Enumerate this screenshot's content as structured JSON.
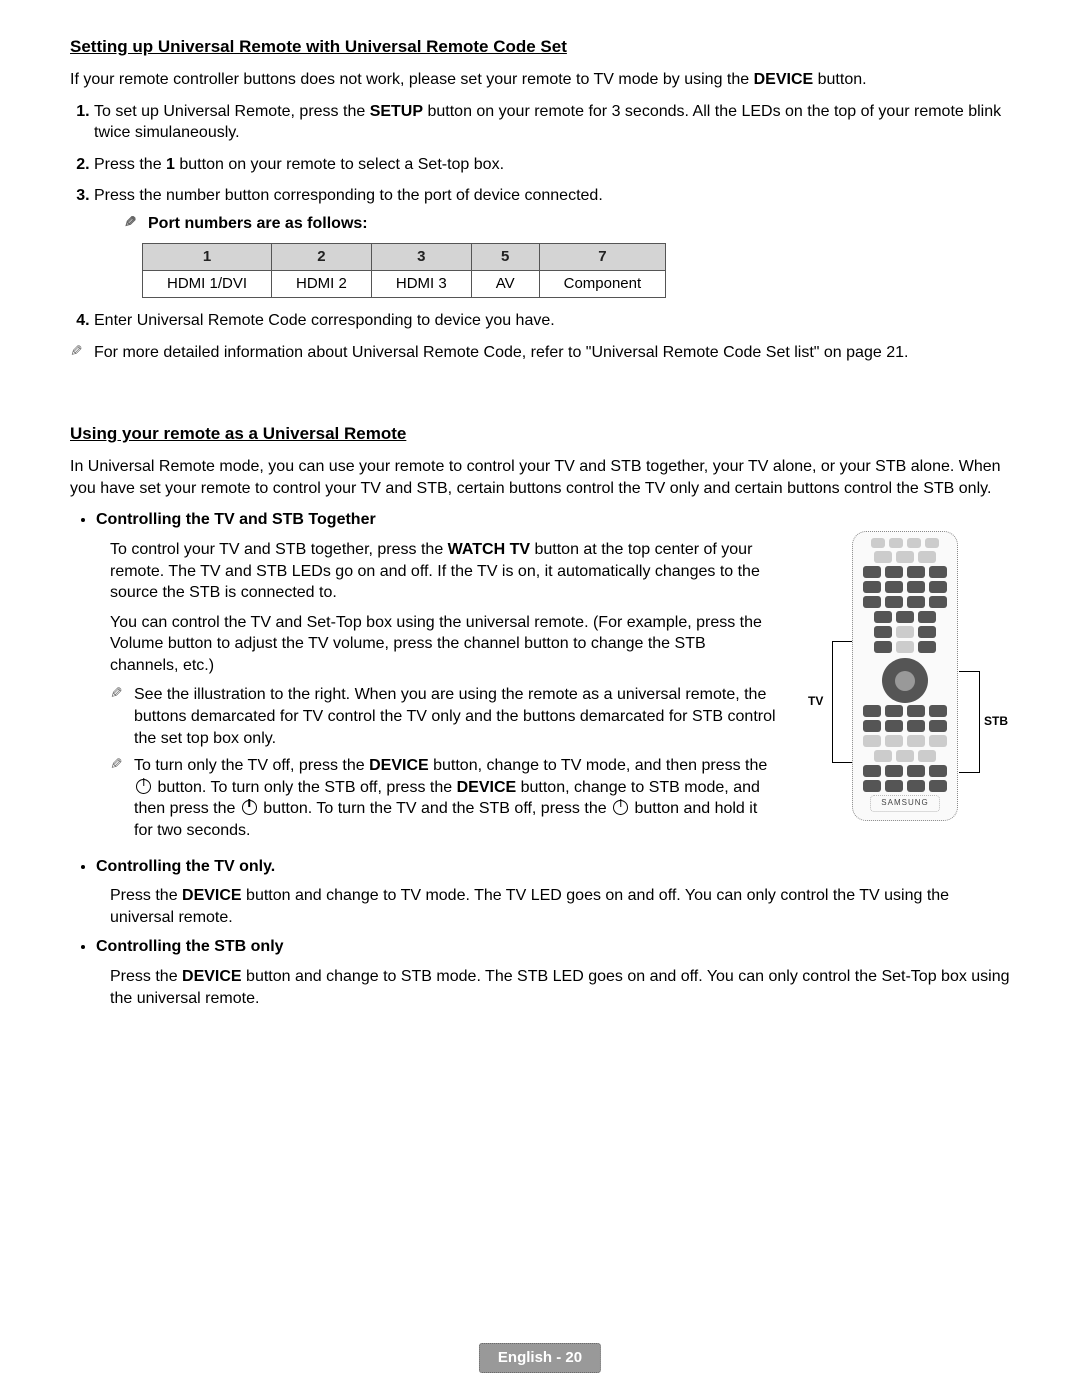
{
  "section1": {
    "title": "Setting up Universal Remote with Universal Remote Code Set",
    "intro_pre": "If your remote controller buttons does not work, please set your remote to TV mode by using the ",
    "intro_bold": "DEVICE",
    "intro_post": " button.",
    "step1_pre": "To set up Universal Remote, press the ",
    "step1_bold": "SETUP",
    "step1_post": " button on your remote for 3 seconds. All the LEDs on the top of your remote blink twice simulaneously.",
    "step2_pre": "Press the ",
    "step2_bold": "1",
    "step2_post": " button on your remote to select a Set-top box.",
    "step3": "Press the number button corresponding to the port of device connected.",
    "step3_note": "Port numbers are as follows:",
    "table": {
      "headers": [
        "1",
        "2",
        "3",
        "5",
        "7"
      ],
      "row": [
        "HDMI 1/DVI",
        "HDMI 2",
        "HDMI 3",
        "AV",
        "Component"
      ]
    },
    "step4": "Enter Universal Remote Code corresponding to device you have.",
    "note_detail": "For more detailed information about Universal Remote Code, refer to \"Universal Remote Code Set list\" on page 21."
  },
  "section2": {
    "title": "Using your remote as a Universal Remote",
    "intro": "In Universal Remote mode, you can use your remote to control your TV and STB together, your TV alone, or your STB alone. When you have set your remote to control your TV and STB, certain buttons control the TV only and certain buttons control the STB only.",
    "b1_head": "Controlling the TV and STB Together",
    "b1_p1_pre": "To control your TV and STB together, press the ",
    "b1_p1_bold": "WATCH TV",
    "b1_p1_post": " button at the top center of your remote. The TV and STB LEDs go on and off. If the TV is on, it automatically changes to the source the STB is connected to.",
    "b1_p2": "You can control the TV and Set-Top box using the universal remote. (For example, press the Volume button to adjust the TV volume, press the channel button to change the STB channels, etc.)",
    "b1_note1": "See the illustration to the right. When you are using the remote as a universal remote, the buttons demarcated for TV control the TV only and the buttons demarcated for STB control the set top box only.",
    "b1_note2_a": "To turn only the TV off, press the ",
    "b1_note2_b": "DEVICE",
    "b1_note2_c": " button, change to TV mode, and then press the ",
    "b1_note2_d": " button. To turn only the STB off, press the ",
    "b1_note2_e": "DEVICE",
    "b1_note2_f": " button, change to STB mode, and then press the ",
    "b1_note2_g": " button. To turn the TV and the STB off, press the ",
    "b1_note2_h": " button and hold it for two seconds.",
    "b2_head": "Controlling the TV only.",
    "b2_p_pre": "Press the ",
    "b2_p_bold": "DEVICE",
    "b2_p_post": " button and change to TV mode. The TV LED goes on and off. You can only control the TV using the universal remote.",
    "b3_head": "Controlling the STB only",
    "b3_p_pre": "Press the ",
    "b3_p_bold": "DEVICE",
    "b3_p_post": " button and change to STB mode. The STB LED goes on and off. You can only control the Set-Top box using the universal remote."
  },
  "figure": {
    "label_tv": "TV",
    "label_stb": "STB",
    "brand": "SAMSUNG"
  },
  "footer": "English - 20"
}
